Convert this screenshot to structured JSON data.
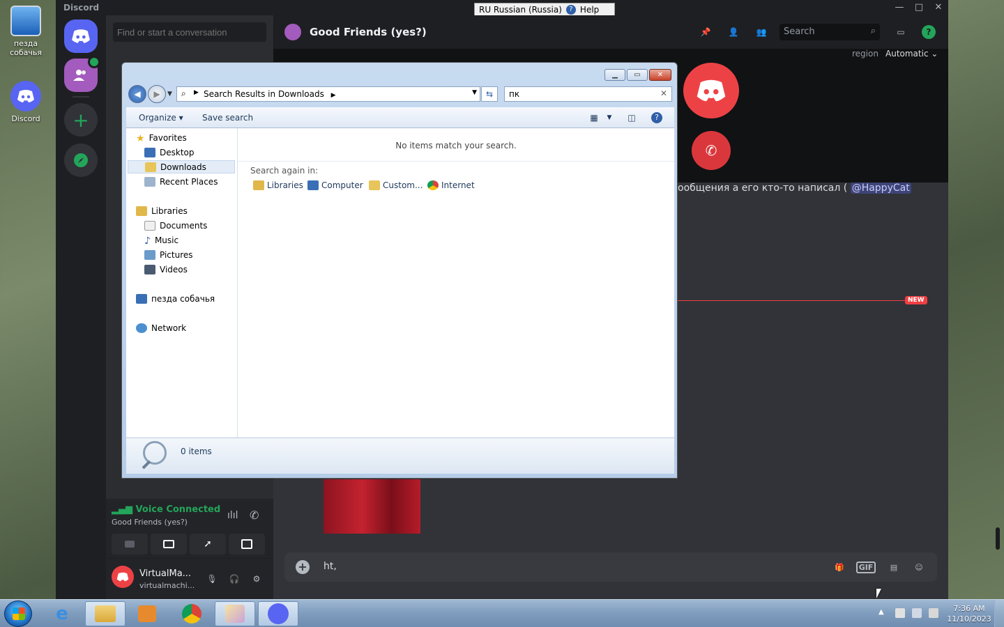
{
  "desktop": {
    "icons": [
      {
        "label": "пезда собачья"
      },
      {
        "label": "Discord"
      }
    ]
  },
  "discord": {
    "brand": "Discord",
    "language_bar": {
      "lang": "RU Russian (Russia)",
      "help": "Help"
    },
    "search_placeholder": "Find or start a conversation",
    "channel_title": "Good Friends (yes?)",
    "header_search_placeholder": "Search",
    "region_label": "region",
    "region_value": "Automatic",
    "message_text": "ообщения а его кто-то написал (",
    "mention": "@HappyCat",
    "new_badge": "NEW",
    "voice": {
      "status": "Voice Connected",
      "channel": "Good Friends (yes?)"
    },
    "user": {
      "name": "VirtualMa...",
      "tag": "virtualmachi..."
    },
    "input_value": "ht,",
    "gif_label": "GIF",
    "accent": "#5865f2",
    "danger": "#da373c"
  },
  "explorer": {
    "address": "Search Results in Downloads",
    "search_value": "пк",
    "toolbar": {
      "organize": "Organize",
      "save_search": "Save search"
    },
    "nav": {
      "favorites": "Favorites",
      "desktop": "Desktop",
      "downloads": "Downloads",
      "recent": "Recent Places",
      "libraries": "Libraries",
      "documents": "Documents",
      "music": "Music",
      "pictures": "Pictures",
      "videos": "Videos",
      "computer": "пезда собачья",
      "network": "Network"
    },
    "no_items": "No items match your search.",
    "search_again": "Search again in:",
    "again_items": [
      "Libraries",
      "Computer",
      "Custom...",
      "Internet"
    ],
    "status": "0 items"
  },
  "taskbar": {
    "time": "7:36 AM",
    "date": "11/10/2023"
  }
}
